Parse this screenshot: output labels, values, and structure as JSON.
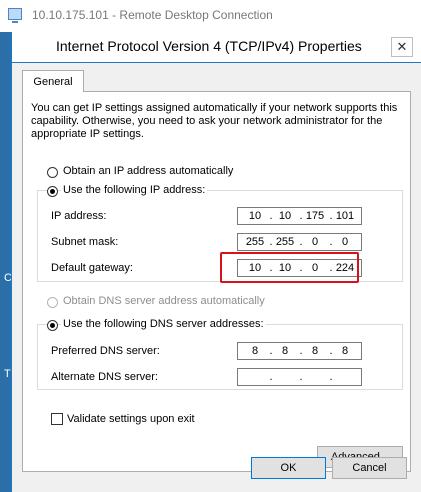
{
  "rdc": {
    "title": "10.10.175.101 - Remote Desktop Connection"
  },
  "desktop": {
    "glyphs": [
      "C",
      "T"
    ]
  },
  "dialog": {
    "title": "Internet Protocol Version 4 (TCP/IPv4) Properties",
    "close_label": "✕",
    "tab_label": "General",
    "description": "You can get IP settings assigned automatically if your network supports this capability. Otherwise, you need to ask your network administrator for the appropriate IP settings.",
    "ip_auto_label": "Obtain an IP address automatically",
    "ip_manual_label": "Use the following IP address:",
    "ip_address_label": "IP address:",
    "ip_address": [
      "10",
      "10",
      "175",
      "101"
    ],
    "subnet_label": "Subnet mask:",
    "subnet": [
      "255",
      "255",
      "0",
      "0"
    ],
    "gateway_label": "Default gateway:",
    "gateway": [
      "10",
      "10",
      "0",
      "224"
    ],
    "dns_auto_label": "Obtain DNS server address automatically",
    "dns_manual_label": "Use the following DNS server addresses:",
    "preferred_dns_label": "Preferred DNS server:",
    "preferred_dns": [
      "8",
      "8",
      "8",
      "8"
    ],
    "alternate_dns_label": "Alternate DNS server:",
    "alternate_dns": [
      "",
      "",
      "",
      ""
    ],
    "validate_label": "Validate settings upon exit",
    "advanced_label": "Advanced...",
    "ok_label": "OK",
    "cancel_label": "Cancel",
    "dot": "."
  },
  "colors": {
    "highlight": "#d4131d",
    "accent": "#1979ca"
  }
}
